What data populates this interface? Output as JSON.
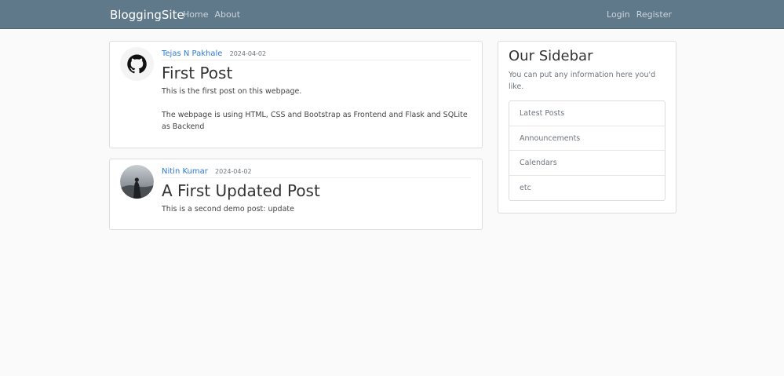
{
  "navbar": {
    "brand": "BloggingSite",
    "left_links": [
      "Home",
      "About"
    ],
    "right_links": [
      "Login",
      "Register"
    ]
  },
  "posts": [
    {
      "author": "Tejas N Pakhale",
      "date": "2024-04-02",
      "title": "First Post",
      "content": "This is the first post on this webpage.\n\nThe webpage is using HTML, CSS and Bootstrap as Frontend and Flask and SQLite as Backend",
      "avatar_icon": "github-logo-icon"
    },
    {
      "author": "Nitin Kumar",
      "date": "2024-04-02",
      "title": "A First Updated Post",
      "content": "This is a second demo post: update",
      "avatar_icon": "profile-photo"
    }
  ],
  "sidebar": {
    "title": "Our Sidebar",
    "text": "You can put any information here you'd like.",
    "items": [
      "Latest Posts",
      "Announcements",
      "Calendars",
      "etc"
    ]
  },
  "colors": {
    "navbar": "#5f788a",
    "link": "#2b7bd8",
    "background": "#fafafa"
  }
}
